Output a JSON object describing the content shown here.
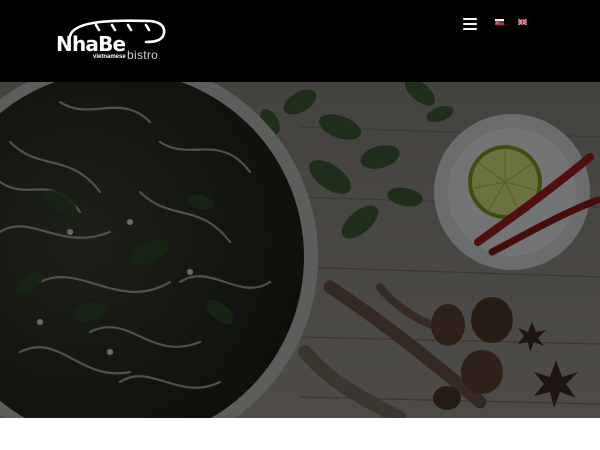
{
  "header": {
    "logo": {
      "main": "NhaBe",
      "sub": "vietnamese",
      "bistro": "bistro"
    },
    "menu_icon": "hamburger-menu-icon",
    "languages": [
      {
        "code": "sk",
        "icon": "slovakia-flag-icon"
      },
      {
        "code": "en",
        "icon": "uk-flag-icon"
      }
    ]
  },
  "hero": {
    "image": "pho-soup-bowl-with-herbs-lime-and-chili",
    "overlay_color": "#000000"
  },
  "colors": {
    "header_bg": "#000000",
    "page_bg": "#ffffff"
  }
}
